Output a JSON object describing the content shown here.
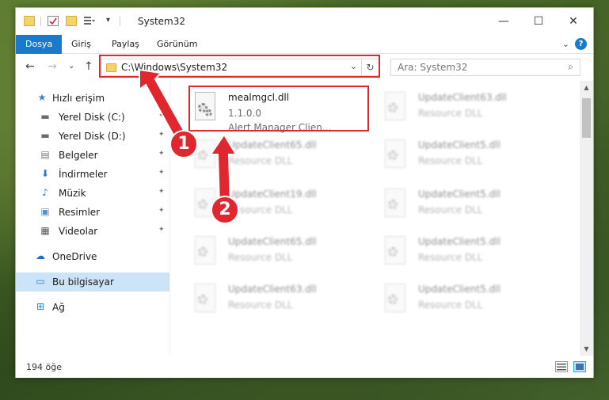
{
  "window": {
    "title": "System32",
    "controls": {
      "minimize": "—",
      "maximize": "☐",
      "close": "✕"
    }
  },
  "ribbon": {
    "tabs": [
      {
        "label": "Dosya",
        "active": true
      },
      {
        "label": "Giriş"
      },
      {
        "label": "Paylaş"
      },
      {
        "label": "Görünüm"
      }
    ],
    "help": "?",
    "expand": "⌄"
  },
  "nav": {
    "back": "←",
    "forward": "→",
    "recent": "⌄",
    "up": "↑",
    "address": "C:\\Windows\\System32",
    "address_dropdown": "⌄",
    "refresh": "↻",
    "search_placeholder": "Ara: System32",
    "search_icon": "⌕"
  },
  "sidebar": {
    "items": [
      {
        "label": "Hızlı erişim",
        "icon": "star-icon",
        "glyph": "★",
        "color": "#3a7fd5"
      },
      {
        "label": "Yerel Disk (C:)",
        "icon": "drive-icon",
        "glyph": "▬",
        "color": "#6b6b6b",
        "pinned": true
      },
      {
        "label": "Yerel Disk (D:)",
        "icon": "drive-icon",
        "glyph": "▬",
        "color": "#6b6b6b",
        "pinned": true
      },
      {
        "label": "Belgeler",
        "icon": "documents-icon",
        "glyph": "▤",
        "color": "#7a7a7a",
        "pinned": true
      },
      {
        "label": "İndirmeler",
        "icon": "download-icon",
        "glyph": "⬇",
        "color": "#2a7ad2",
        "pinned": true
      },
      {
        "label": "Müzik",
        "icon": "music-icon",
        "glyph": "♪",
        "color": "#2a7ad2",
        "pinned": true
      },
      {
        "label": "Resimler",
        "icon": "pictures-icon",
        "glyph": "▣",
        "color": "#5a8fc7",
        "pinned": true
      },
      {
        "label": "Videolar",
        "icon": "video-icon",
        "glyph": "▦",
        "color": "#555555",
        "pinned": true
      },
      {
        "label": "OneDrive",
        "icon": "cloud-icon",
        "glyph": "☁",
        "color": "#1c6fcf"
      },
      {
        "label": "Bu bilgisayar",
        "icon": "computer-icon",
        "glyph": "▭",
        "color": "#2a7ad2",
        "selected": true
      },
      {
        "label": "Ağ",
        "icon": "network-icon",
        "glyph": "⊞",
        "color": "#2a7ad2"
      }
    ],
    "pin_glyph": "📌"
  },
  "files": [
    {
      "name": "mealmgcl.dll",
      "line2": "1.1.0.0",
      "line3": "Alert Manager Clien...",
      "highlight": true
    },
    {
      "name": "UpdateClient63.dll",
      "line2": "Resource DLL",
      "blurred": true
    },
    {
      "name": "UpdateClient65.dll",
      "line2": "Resource DLL",
      "blurred": true
    },
    {
      "name": "UpdateClient5.dll",
      "line2": "Resource DLL",
      "blurred": true
    },
    {
      "name": "UpdateClient19.dll",
      "line2": "Resource DLL",
      "blurred": true
    },
    {
      "name": "UpdateClient5.dll",
      "line2": "Resource DLL",
      "blurred": true
    },
    {
      "name": "UpdateClient65.dll",
      "line2": "Resource DLL",
      "blurred": true
    },
    {
      "name": "UpdateClient5.dll",
      "line2": "Resource DLL",
      "blurred": true
    },
    {
      "name": "UpdateClient63.dll",
      "line2": "Resource DLL",
      "blurred": true
    },
    {
      "name": "UpdateClient5.dll",
      "line2": "Resource DLL",
      "blurred": true
    }
  ],
  "status": {
    "count": "194 öğe"
  },
  "annotations": {
    "step1": "1",
    "step2": "2",
    "color": "#e0262f"
  }
}
